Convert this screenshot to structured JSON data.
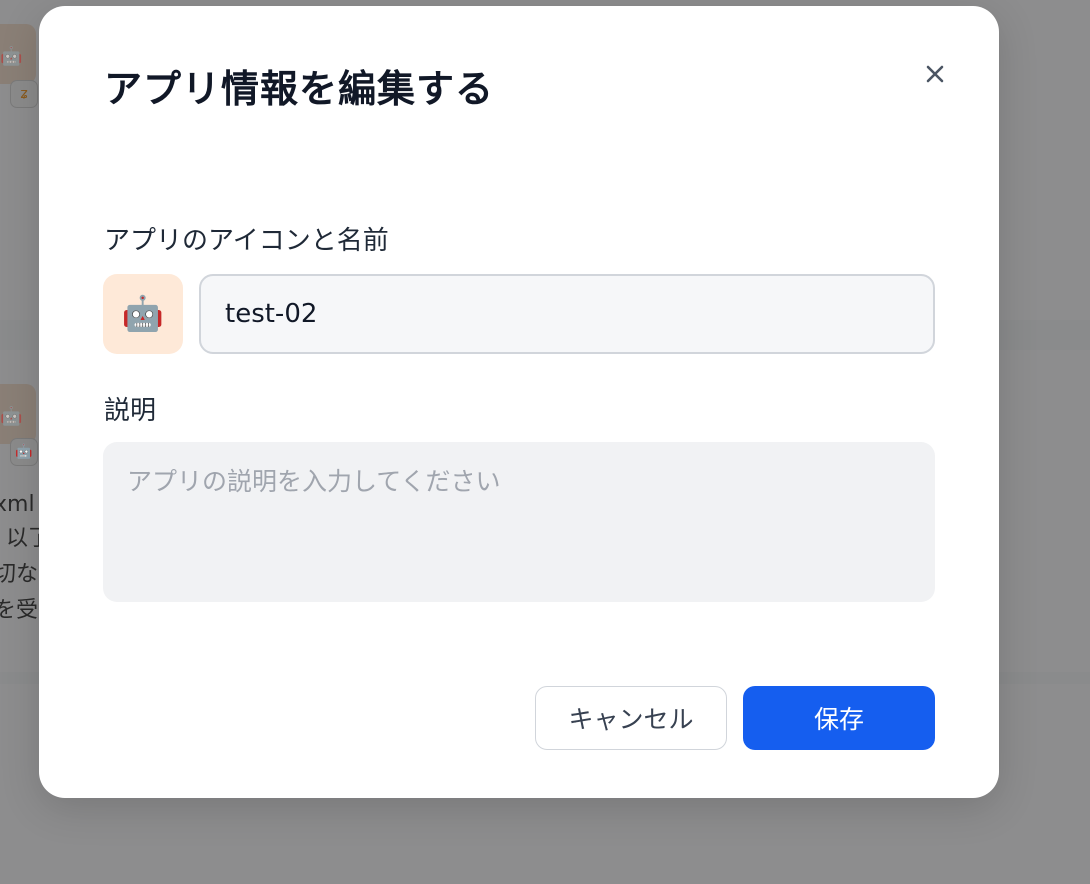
{
  "dialog": {
    "title": "アプリ情報を編集する",
    "close_icon": "close-icon",
    "icon_name_label": "アプリのアイコンと名前",
    "app_icon": "🤖",
    "app_icon_name": "robot-face-icon",
    "app_name_value": "test-02",
    "description_label": "説明",
    "description_placeholder": "アプリの説明を入力してください",
    "description_value": "",
    "cancel_label": "キャンセル",
    "save_label": "保存"
  },
  "background": {
    "card_icon": "🤖",
    "badge_1_icon": "workflow-icon",
    "badge_1_glyph": "ʑ",
    "badge_2_icon": "robot-icon",
    "badge_2_glyph": "🤖",
    "text_lines": [
      "xml -",
      "以了",
      "切な",
      "を受"
    ]
  },
  "colors": {
    "primary": "#155eef",
    "icon_bg": "#fee9d8",
    "overlay": "#8a8b8c"
  }
}
